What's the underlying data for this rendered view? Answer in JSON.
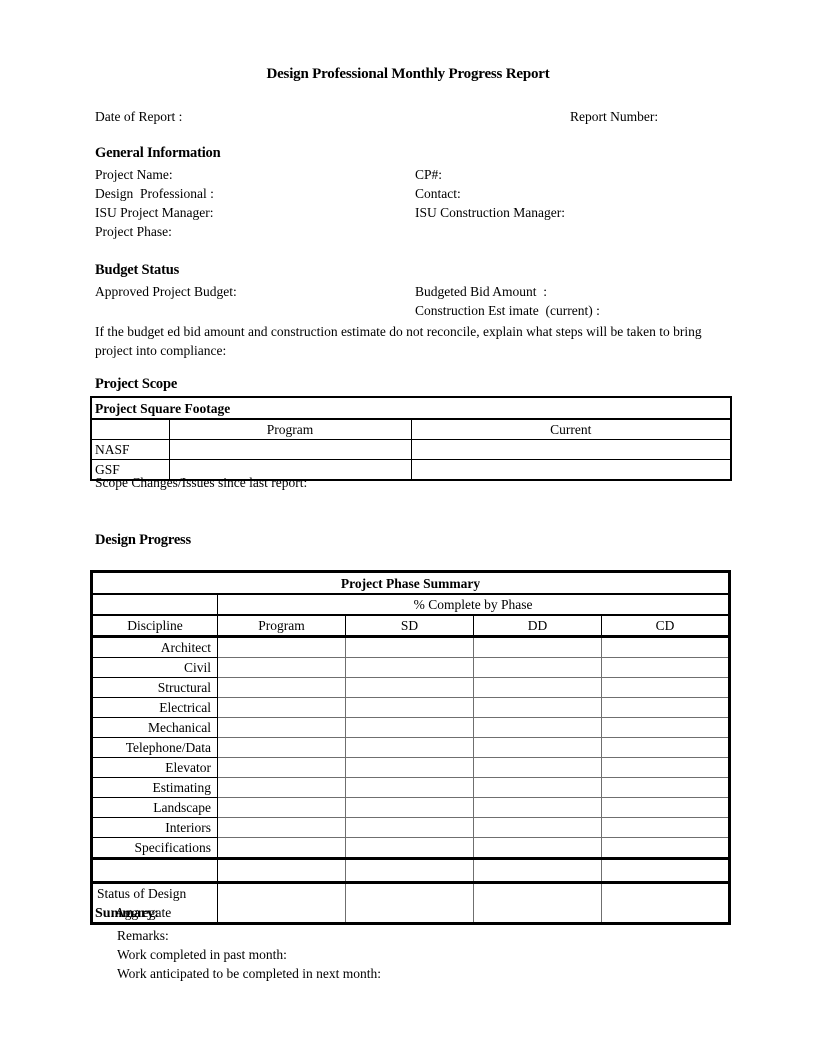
{
  "document": {
    "title": "Design Professional Monthly Progress Report"
  },
  "header": {
    "date_of_report_label": "Date of Report :",
    "report_number_label": "Report Number:"
  },
  "general_information": {
    "heading": "General Information",
    "left_fields": [
      "Project Name:",
      "Design  Professional :",
      "ISU Project Manager:",
      "Project Phase:"
    ],
    "right_fields": [
      "CP#:",
      "Contact:",
      "ISU Construction Manager:"
    ]
  },
  "budget_status": {
    "heading": "Budget Status",
    "approved_project_budget_label": "Approved Project Budget:",
    "budgeted_bid_amount_label": "Budgeted Bid Amount  :",
    "construction_estimate_label": "Construction Est imate  (current) :",
    "reconcile_note": "If the budget ed bid amount  and construction estimate do not reconcile,  explain what steps will be taken to bring project into compliance:"
  },
  "project_scope": {
    "heading": "Project Scope",
    "table": {
      "caption": "Project Square Footage",
      "columns": [
        "",
        "Program",
        "Current"
      ],
      "rows": [
        {
          "label": "NASF",
          "program": "",
          "current": ""
        },
        {
          "label": "GSF",
          "program": "",
          "current": ""
        }
      ]
    },
    "scope_changes_label": "Scope Changes/Issues since last report:"
  },
  "design_progress": {
    "heading": "Design Progress",
    "table": {
      "caption": "Project Phase Summary",
      "group_header": "% Complete by Phase",
      "columns": [
        "Discipline",
        "Program",
        "SD",
        "DD",
        "CD"
      ],
      "disciplines": [
        "Architect",
        "Civil",
        "Structural",
        "Electrical",
        "Mechanical",
        "Telephone/Data",
        "Elevator",
        "Estimating",
        "Landscape",
        "Interiors",
        "Specifications"
      ],
      "status_row": {
        "line1": "Status of Design",
        "line2": "Aggregate"
      }
    }
  },
  "summary": {
    "heading": "Summary:",
    "lines": [
      "Remarks:",
      "Work completed in past month:",
      "Work anticipated to be completed in next month:"
    ]
  }
}
